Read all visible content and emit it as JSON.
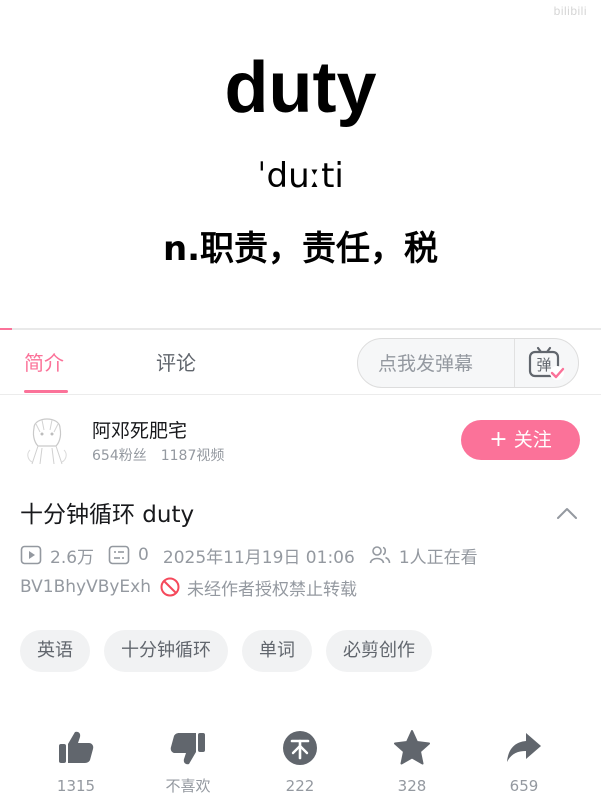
{
  "video": {
    "watermark": "bilibili",
    "word": "duty",
    "phonetic": "ˈduːti",
    "meaning": "n.职责，责任，税",
    "progress": 0.02
  },
  "tabs": {
    "intro": "简介",
    "comments": "评论"
  },
  "danmaku": {
    "placeholder": "点我发弹幕",
    "icon": "danmaku-toggle-icon"
  },
  "uploader": {
    "name": "阿邓死肥宅",
    "followers": "654粉丝",
    "videos": "1187视频",
    "follow_label": "关注"
  },
  "title": "十分钟循环 duty",
  "meta": {
    "views": "2.6万",
    "danmaku_count": "0",
    "datetime": "2025年11月19日 01:06",
    "watching": "1人正在看",
    "bvid": "BV1BhyVByExh",
    "copyright": "未经作者授权禁止转载"
  },
  "tags": [
    "英语",
    "十分钟循环",
    "单词",
    "必剪创作"
  ],
  "actions": {
    "like": "1315",
    "dislike": "不喜欢",
    "coin": "222",
    "favorite": "328",
    "share": "659"
  },
  "colors": {
    "accent": "#fb7299",
    "muted": "#9499a0",
    "text": "#18191c",
    "icon": "#61666d"
  }
}
